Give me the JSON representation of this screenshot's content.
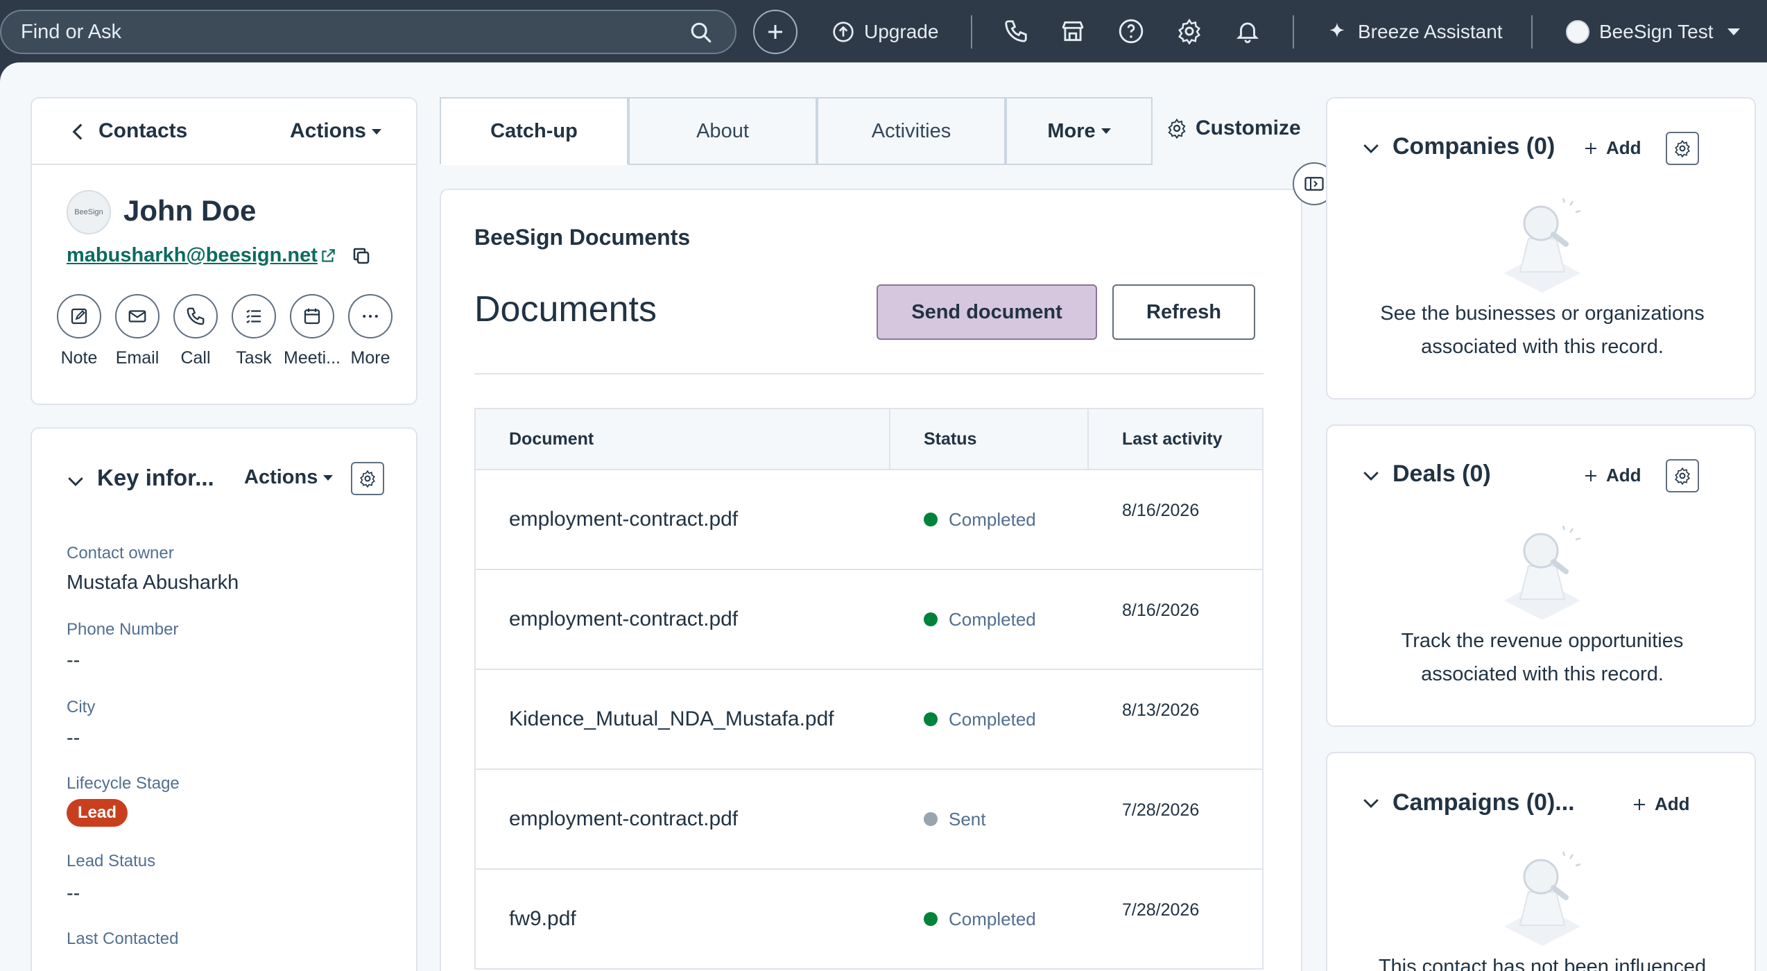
{
  "topnav": {
    "search_placeholder": "Find or Ask",
    "upgrade_label": "Upgrade",
    "assistant_label": "Breeze Assistant",
    "account_label": "BeeSign Test"
  },
  "contact": {
    "breadcrumb": "Contacts",
    "actions_label": "Actions",
    "avatar_text": "BeeSign",
    "name": "John Doe",
    "email": "mabusharkh@beesign.net",
    "quick_actions": [
      "Note",
      "Email",
      "Call",
      "Task",
      "Meeti...",
      "More"
    ]
  },
  "key_info": {
    "title": "Key infor...",
    "actions_label": "Actions",
    "properties": [
      {
        "label": "Contact owner",
        "value": "Mustafa Abusharkh"
      },
      {
        "label": "Phone Number",
        "value": "--"
      },
      {
        "label": "City",
        "value": "--"
      },
      {
        "label": "Lifecycle Stage",
        "value": "Lead"
      },
      {
        "label": "Lead Status",
        "value": "--"
      },
      {
        "label": "Last Contacted",
        "value": "--"
      }
    ]
  },
  "tabs": {
    "items": [
      "Catch-up",
      "About",
      "Activities",
      "More"
    ],
    "customize_label": "Customize"
  },
  "documents": {
    "card_title": "BeeSign Documents",
    "heading": "Documents",
    "send_label": "Send document",
    "refresh_label": "Refresh",
    "columns": [
      "Document",
      "Status",
      "Last activity"
    ],
    "rows": [
      {
        "document": "employment-contract.pdf",
        "status": "Completed",
        "date": "8/16/2026"
      },
      {
        "document": "employment-contract.pdf",
        "status": "Completed",
        "date": "8/16/2026"
      },
      {
        "document": "Kidence_Mutual_NDA_Mustafa.pdf",
        "status": "Completed",
        "date": "8/13/2026"
      },
      {
        "document": "employment-contract.pdf",
        "status": "Sent",
        "date": "7/28/2026"
      },
      {
        "document": "fw9.pdf",
        "status": "Completed",
        "date": "7/28/2026"
      }
    ]
  },
  "right_panel": {
    "add_label": "Add",
    "companies": {
      "title": "Companies (0)",
      "desc": "See the businesses or organizations associated with this record."
    },
    "deals": {
      "title": "Deals (0)",
      "desc": "Track the revenue opportunities associated with this record."
    },
    "campaigns": {
      "title": "Campaigns (0)...",
      "desc": "This contact has not been influenced"
    }
  },
  "colors": {
    "nav_bg": "#2e3a47",
    "completed": "#00823a",
    "sent": "#99a4ae",
    "lead_badge": "#c93f1e",
    "send_button": "#d7c7de",
    "link": "#0b6b5f"
  }
}
